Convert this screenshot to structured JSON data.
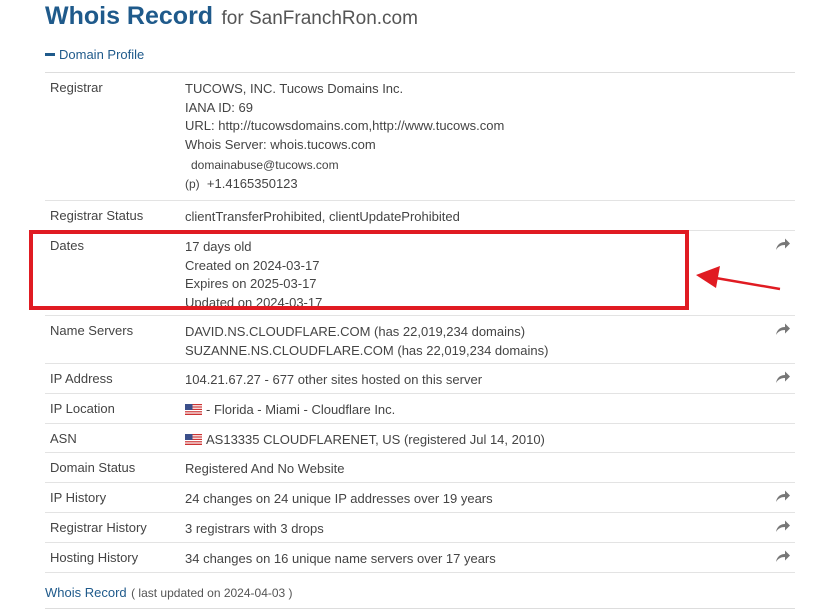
{
  "header": {
    "title": "Whois Record",
    "subtitle": "for SanFranchRon.com"
  },
  "section": {
    "label": "Domain Profile"
  },
  "rows": {
    "registrar": {
      "label": "Registrar",
      "lines": [
        "TUCOWS, INC. Tucows Domains Inc.",
        "IANA ID: 69",
        "URL: http://tucowsdomains.com,http://www.tucows.com",
        "Whois Server: whois.tucows.com"
      ],
      "email": "domainabuse@tucows.com",
      "phone_prefix": "(p)",
      "phone": "+1.4165350123"
    },
    "registrar_status": {
      "label": "Registrar Status",
      "value": "clientTransferProhibited, clientUpdateProhibited"
    },
    "dates": {
      "label": "Dates",
      "lines": [
        "17 days old",
        "Created on 2024-03-17",
        "Expires on 2025-03-17",
        "Updated on 2024-03-17"
      ]
    },
    "name_servers": {
      "label": "Name Servers",
      "lines": [
        "DAVID.NS.CLOUDFLARE.COM (has 22,019,234 domains)",
        "SUZANNE.NS.CLOUDFLARE.COM (has 22,019,234 domains)"
      ]
    },
    "ip_address": {
      "label": "IP Address",
      "value": "104.21.67.27 - 677 other sites hosted on this server"
    },
    "ip_location": {
      "label": "IP Location",
      "value": "- Florida - Miami - Cloudflare Inc."
    },
    "asn": {
      "label": "ASN",
      "value": "AS13335 CLOUDFLARENET, US (registered Jul 14, 2010)"
    },
    "domain_status": {
      "label": "Domain Status",
      "value": "Registered And No Website"
    },
    "ip_history": {
      "label": "IP History",
      "value": "24 changes on 24 unique IP addresses over 19 years"
    },
    "registrar_history": {
      "label": "Registrar History",
      "value": "3 registrars with 3 drops"
    },
    "hosting_history": {
      "label": "Hosting History",
      "value": "34 changes on 16 unique name servers over 17 years"
    }
  },
  "footer": {
    "title": "Whois Record",
    "updated": "( last updated on 2024-04-03 )"
  },
  "colors": {
    "link": "#1f5a8b",
    "highlight": "#e01b22"
  }
}
